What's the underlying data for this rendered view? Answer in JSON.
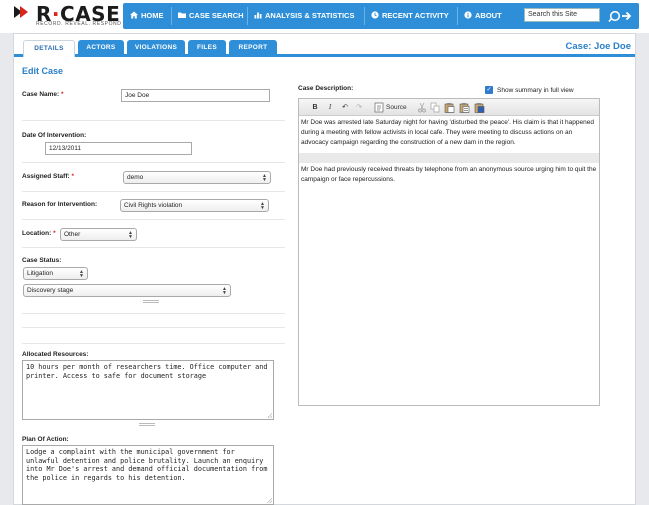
{
  "brand": {
    "name_left": "R",
    "name_right": "CASE",
    "tagline": "RECORD. REVEAL. RESPOND",
    "accent": "#2e8fd8",
    "logo_red": "#d7261e"
  },
  "nav": {
    "items": [
      {
        "label": "HOME",
        "icon": "home-icon"
      },
      {
        "label": "CASE SEARCH",
        "icon": "folder-icon"
      },
      {
        "label": "ANALYSIS & STATISTICS",
        "icon": "chart-icon"
      },
      {
        "label": "RECENT ACTIVITY",
        "icon": "clock-icon"
      },
      {
        "label": "ABOUT",
        "icon": "info-icon"
      }
    ],
    "search_value": "Search this Site",
    "search_button_icon": "search-arrow-icon"
  },
  "tabs": [
    {
      "label": "DETAILS",
      "active": true
    },
    {
      "label": "ACTORS",
      "active": false
    },
    {
      "label": "VIOLATIONS",
      "active": false
    },
    {
      "label": "FILES",
      "active": false
    },
    {
      "label": "REPORT",
      "active": false
    }
  ],
  "case_title": "Case: Joe Doe",
  "form": {
    "heading": "Edit Case",
    "case_name": {
      "label": "Case Name:",
      "required": "*",
      "value": "Joe Doe"
    },
    "date": {
      "label": "Date Of Intervention:",
      "value": "12/13/2011"
    },
    "staff": {
      "label": "Assigned Staff:",
      "required": "*",
      "value": "demo"
    },
    "reason": {
      "label": "Reason for Intervention:",
      "value": "Civil Rights violation"
    },
    "location": {
      "label": "Location:",
      "required": "*",
      "value": "Other"
    },
    "status": {
      "label": "Case Status:",
      "value": "Litigation",
      "stage": "Discovery stage"
    },
    "resources": {
      "label": "Allocated Resources:",
      "value": "10 hours per month of researchers time. Office computer and printer. Access to safe for document storage"
    },
    "plan": {
      "label": "Plan Of Action:",
      "value": "Lodge a complaint with the municipal government for unlawful detention and police brutality. Launch an enquiry into Mr Doe's arrest and demand official documentation from the police in regards to his detention."
    },
    "description": {
      "label": "Case Description:",
      "summary_label": "Show summary in full view",
      "summary_checked": true,
      "toolbar": {
        "bold": "B",
        "italic": "I",
        "undo": "↶",
        "redo": "↷",
        "source": "Source"
      },
      "paragraph1": "Mr Doe was arrested late Saturday night for having 'disturbed the peace'. His claim is that it happened during a meeting with fellow activists in local cafe. They were meeting to discuss actions on an advocacy campaign regarding the construction of a new dam in the region.",
      "paragraph2": "Mr Doe had previously received threats by telephone from an anonymous source urging him to quit the campaign or face repercussions."
    }
  }
}
